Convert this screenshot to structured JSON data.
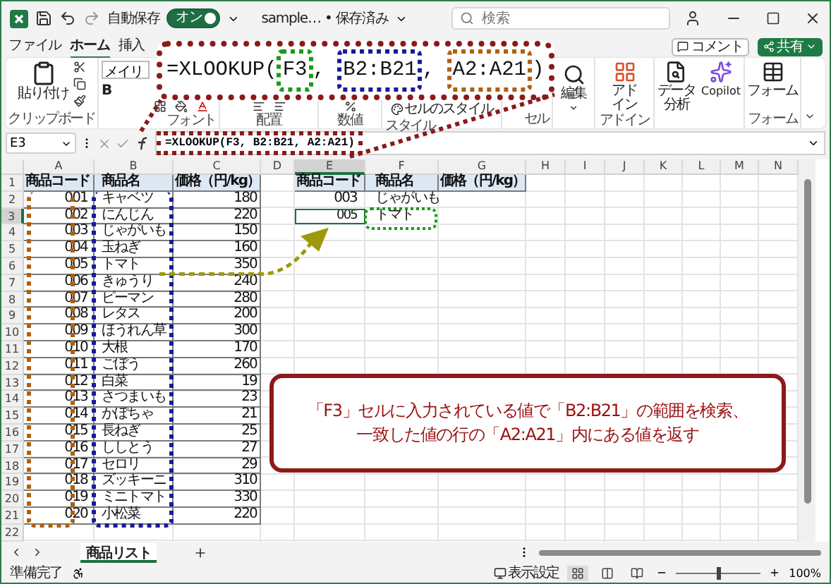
{
  "title_bar": {
    "autosave_label": "自動保存",
    "autosave": {
      "on": true,
      "label": "オン"
    },
    "file_name": "sample… • 保存済み",
    "search_placeholder": "検索"
  },
  "ribbon_tabs": [
    {
      "label": "ファイル",
      "selected": false
    },
    {
      "label": "ホーム",
      "selected": true
    },
    {
      "label": "挿入",
      "selected": false
    }
  ],
  "ribbon_actions": {
    "comment": "コメント",
    "share": "共有"
  },
  "ribbon": {
    "paste": "貼り付け",
    "clipboard": "クリップボード",
    "font_name": "メイリ",
    "bold": "B",
    "font": "フォント",
    "alignment": "配置",
    "number": "数値",
    "cell_styles": "セルのスタイル",
    "styles": "スタイル",
    "cells": "セル",
    "editing": "編集",
    "addins_button": [
      "アド",
      "イン"
    ],
    "addins_group": "アドイン",
    "data_analysis": [
      "データ",
      "分析"
    ],
    "copilot": "Copilot",
    "form_button": "フォーム",
    "form_group": "フォーム"
  },
  "formula_bar": {
    "name_box": "E3",
    "formula": "=XLOOKUP(F3, B2:B21, A2:A21)"
  },
  "columns": [
    {
      "letter": "A",
      "selected": false
    },
    {
      "letter": "B",
      "selected": false
    },
    {
      "letter": "C",
      "selected": false
    },
    {
      "letter": "D",
      "selected": false
    },
    {
      "letter": "E",
      "selected": true
    },
    {
      "letter": "F",
      "selected": false
    },
    {
      "letter": "G",
      "selected": false
    },
    {
      "letter": "H",
      "selected": false
    },
    {
      "letter": "I",
      "selected": false
    },
    {
      "letter": "J",
      "selected": false
    },
    {
      "letter": "K",
      "selected": false
    },
    {
      "letter": "L",
      "selected": false
    },
    {
      "letter": "M",
      "selected": false
    },
    {
      "letter": "N",
      "selected": false
    }
  ],
  "rows": [
    {
      "number": "1",
      "kind": "header",
      "selected": false,
      "code": "商品コード",
      "name": "商品名",
      "price": "価格（円/kg）",
      "lookup_code": "商品コード",
      "lookup_name": "商品名",
      "lookup_price": "価格（円/kg）"
    },
    {
      "number": "2",
      "kind": "data",
      "selected": false,
      "code": "001",
      "name": "キャベツ",
      "price": "180",
      "lookup_code": "003",
      "lookup_name": "じゃがいも"
    },
    {
      "number": "3",
      "kind": "data",
      "selected": true,
      "code": "002",
      "name": "にんじん",
      "price": "220",
      "lookup_code": "005",
      "lookup_name": "トマト"
    },
    {
      "number": "4",
      "kind": "data",
      "selected": false,
      "code": "003",
      "name": "じゃがいも",
      "price": "150"
    },
    {
      "number": "5",
      "kind": "data",
      "selected": false,
      "code": "004",
      "name": "玉ねぎ",
      "price": "160"
    },
    {
      "number": "6",
      "kind": "data",
      "selected": false,
      "code": "005",
      "name": "トマト",
      "price": "350"
    },
    {
      "number": "7",
      "kind": "data",
      "selected": false,
      "code": "006",
      "name": "きゅうり",
      "price": "240"
    },
    {
      "number": "8",
      "kind": "data",
      "selected": false,
      "code": "007",
      "name": "ピーマン",
      "price": "280"
    },
    {
      "number": "9",
      "kind": "data",
      "selected": false,
      "code": "008",
      "name": "レタス",
      "price": "200"
    },
    {
      "number": "10",
      "kind": "data",
      "selected": false,
      "code": "009",
      "name": "ほうれん草",
      "price": "300"
    },
    {
      "number": "11",
      "kind": "data",
      "selected": false,
      "code": "010",
      "name": "大根",
      "price": "170"
    },
    {
      "number": "12",
      "kind": "data",
      "selected": false,
      "code": "011",
      "name": "ごぼう",
      "price": "260"
    },
    {
      "number": "13",
      "kind": "data",
      "selected": false,
      "code": "012",
      "name": "白菜",
      "price": "19"
    },
    {
      "number": "14",
      "kind": "data",
      "selected": false,
      "code": "013",
      "name": "さつまいも",
      "price": "23"
    },
    {
      "number": "15",
      "kind": "data",
      "selected": false,
      "code": "014",
      "name": "かぼちゃ",
      "price": "21"
    },
    {
      "number": "16",
      "kind": "data",
      "selected": false,
      "code": "015",
      "name": "長ねぎ",
      "price": "25"
    },
    {
      "number": "17",
      "kind": "data",
      "selected": false,
      "code": "016",
      "name": "ししとう",
      "price": "27"
    },
    {
      "number": "18",
      "kind": "data",
      "selected": false,
      "code": "017",
      "name": "セロリ",
      "price": "29"
    },
    {
      "number": "19",
      "kind": "data",
      "selected": false,
      "code": "018",
      "name": "ズッキーニ",
      "price": "310"
    },
    {
      "number": "20",
      "kind": "data",
      "selected": false,
      "code": "019",
      "name": "ミニトマト",
      "price": "330"
    },
    {
      "number": "21",
      "kind": "data",
      "selected": false,
      "code": "020",
      "name": "小松菜",
      "price": "220"
    },
    {
      "number": "22",
      "kind": "empty",
      "selected": false
    }
  ],
  "sheet_tabs": [
    {
      "label": "商品リスト",
      "selected": true
    }
  ],
  "status_bar": {
    "ready": "準備完了",
    "display_settings": "表示設定",
    "view_buttons": [
      {
        "kind": "normal",
        "selected": true
      },
      {
        "kind": "page_layout",
        "selected": false
      },
      {
        "kind": "page_break",
        "selected": false
      }
    ],
    "zoom_slider": {
      "level": 0.5
    },
    "zoom": "100%"
  },
  "annotations": {
    "formula_zoom": [
      {
        "text": "=XLOOKUP(",
        "kind": "plain"
      },
      {
        "text": "F3",
        "kind": "framed",
        "color": "#1a9a1a"
      },
      {
        "text": ", ",
        "kind": "plain"
      },
      {
        "text": "B2:B21",
        "kind": "framed",
        "color": "#1a1a9a"
      },
      {
        "text": ", ",
        "kind": "plain"
      },
      {
        "text": "A2:A21",
        "kind": "framed",
        "color": "#b0600f"
      },
      {
        "text": ")",
        "kind": "plain"
      }
    ],
    "callout": [
      "「F3」セルに入力されている値で「B2:B21」の範囲を検索、",
      "一致した値の行の「A2:A21」内にある値を返す"
    ]
  }
}
